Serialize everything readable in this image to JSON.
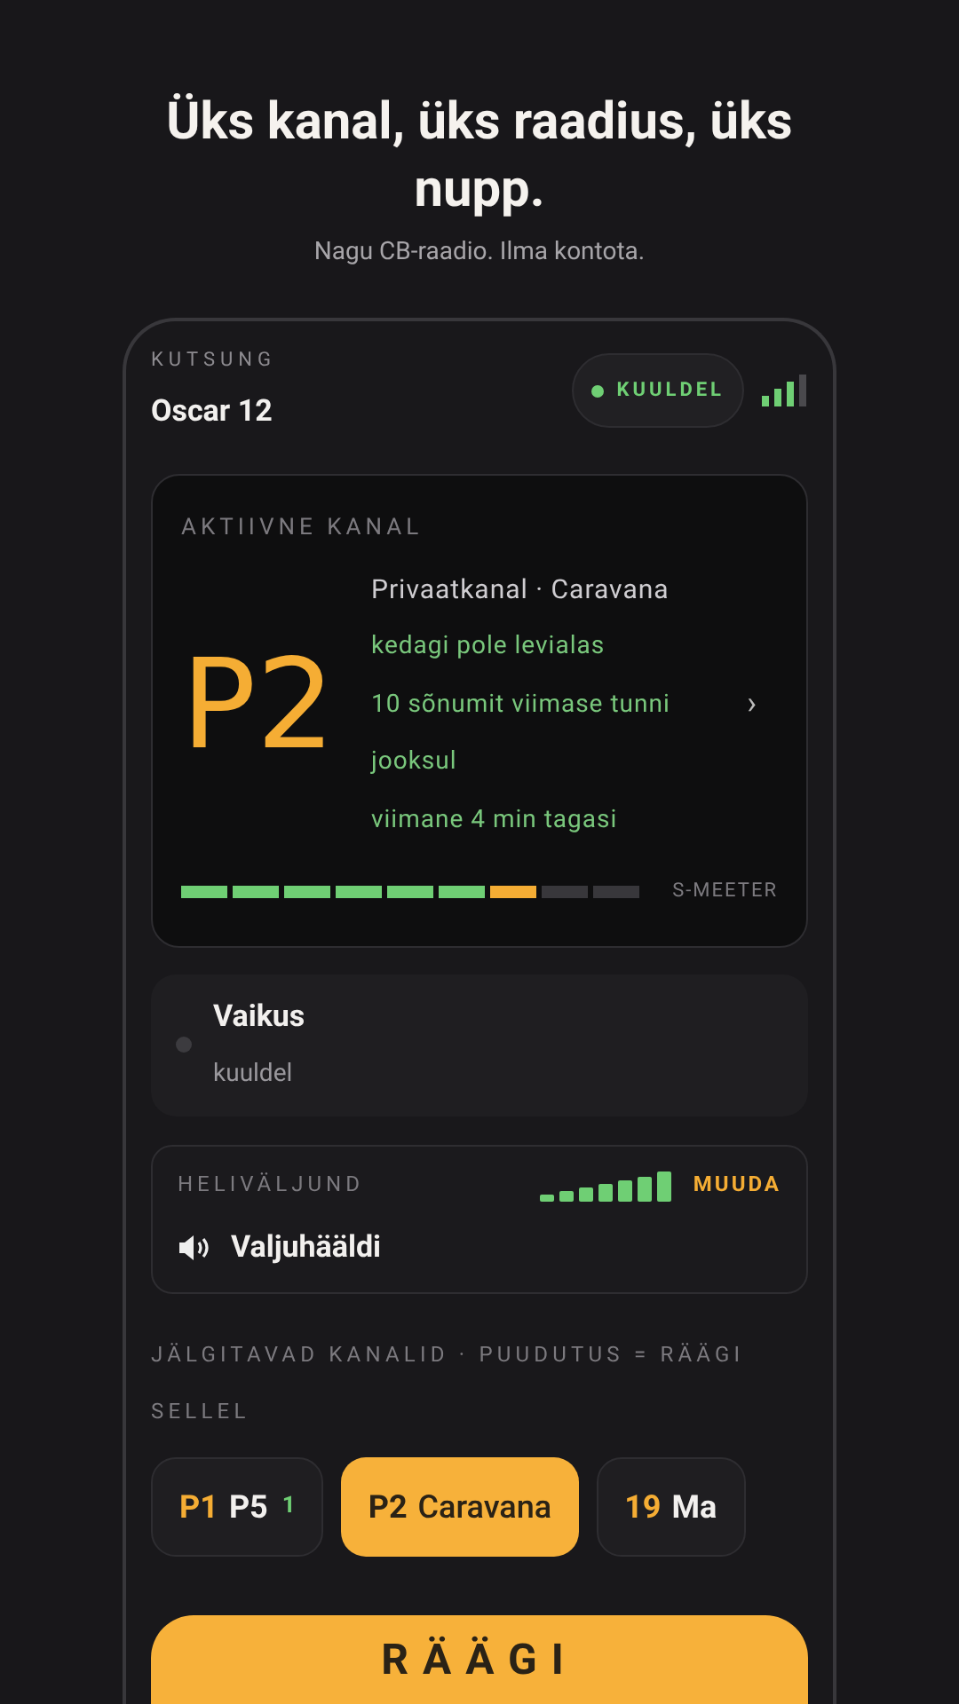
{
  "hero": {
    "title": "Üks kanal, üks raadius, üks nupp.",
    "subtitle": "Nagu CB-raadio. Ilma kontota."
  },
  "callsign": {
    "label": "KUTSUNG",
    "value": "Oscar 12"
  },
  "status": {
    "label": "KUULDEL"
  },
  "active_channel": {
    "label": "AKTIIVNE KANAL",
    "code": "P2",
    "lines": [
      {
        "text": "Privaatkanal · Caravana",
        "kind": "title"
      },
      {
        "text": "kedagi pole levialas",
        "kind": "info"
      },
      {
        "text": "10 sõnumit viimase tunni jooksul",
        "kind": "info"
      },
      {
        "text": "viimane 4 min tagasi",
        "kind": "info"
      }
    ],
    "chevron": "›",
    "meter": {
      "level": 0.78,
      "label": "S-MEETER"
    }
  },
  "presence": {
    "title": "Vaikus",
    "subtitle": "kuuldel"
  },
  "audio": {
    "label": "HELIVÄLJUND",
    "action": "MUUDA",
    "value": "Valjuhääldi"
  },
  "channels_label": "JÄLGITAVAD KANALID · PUUDUTUS = RÄÄGI SELLEL",
  "channels": [
    {
      "code": "P1",
      "name": "P5",
      "badge": "1",
      "selected": false
    },
    {
      "code": "P2",
      "name": "Caravana",
      "selected": true
    },
    {
      "code": "19",
      "name": "Ma",
      "selected": false
    }
  ],
  "talk_button": "RÄÄGI"
}
